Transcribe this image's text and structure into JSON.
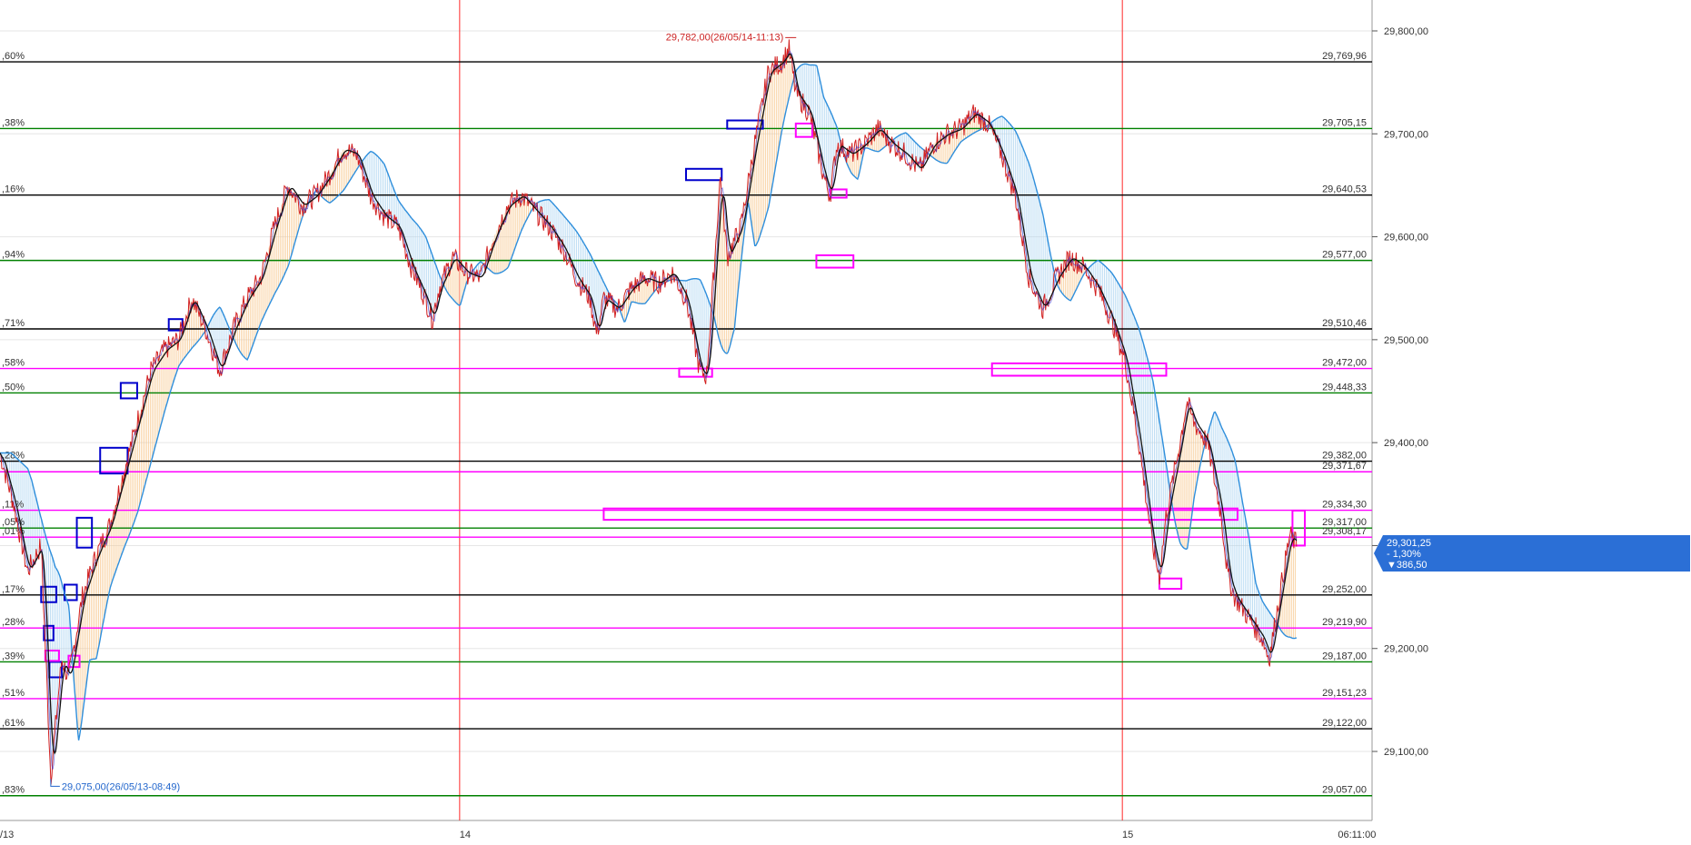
{
  "chart_data": {
    "type": "line",
    "x": [
      "14",
      "15"
    ],
    "y_axis": {
      "ylim": [
        29040,
        29830
      ],
      "ticks": [
        29100,
        29200,
        29300,
        29400,
        29500,
        29600,
        29700,
        29800
      ],
      "tick_labels": [
        "29,100,00",
        "29,200,00",
        "29,300,00",
        "29,400,00",
        "29,500,00",
        "29,600,00",
        "29,700,00",
        "29,800,00"
      ]
    },
    "x_axis": {
      "labels": [
        {
          "text": "/13",
          "frac": 0.0
        },
        {
          "text": "14",
          "frac": 0.335
        },
        {
          "text": "15",
          "frac": 0.818
        },
        {
          "text": "06:11:00",
          "frac": 0.985
        }
      ],
      "day_separators_frac": [
        0.335,
        0.818
      ]
    },
    "fib_levels": [
      {
        "pct": ",60%",
        "value": 29769.96,
        "label": "29,769,96",
        "color": "#000000"
      },
      {
        "pct": ",38%",
        "value": 29705.15,
        "label": "29,705,15",
        "color": "#008000"
      },
      {
        "pct": ",16%",
        "value": 29640.53,
        "label": "29,640,53",
        "color": "#000000"
      },
      {
        "pct": ",94%",
        "value": 29577.0,
        "label": "29,577,00",
        "color": "#008000"
      },
      {
        "pct": ",71%",
        "value": 29510.46,
        "label": "29,510,46",
        "color": "#000000"
      },
      {
        "pct": ",58%",
        "value": 29472.0,
        "label": "29,472,00",
        "color": "#ff00ff"
      },
      {
        "pct": ",50%",
        "value": 29448.33,
        "label": "29,448,33",
        "color": "#008000"
      },
      {
        "pct": ",28%",
        "value": 29382.0,
        "label": "29,382,00",
        "color": "#000000"
      },
      {
        "pct": "",
        "value": 29371.67,
        "label": "29,371,67",
        "color": "#ff00ff"
      },
      {
        "pct": ",11%",
        "value": 29334.3,
        "label": "29,334,30",
        "color": "#ff00ff"
      },
      {
        "pct": ",05%",
        "value": 29317.0,
        "label": "29,317,00",
        "color": "#008000"
      },
      {
        "pct": ",01%",
        "value": 29308.17,
        "label": "29,308,17",
        "color": "#ff00ff"
      },
      {
        "pct": ",17%",
        "value": 29252.0,
        "label": "29,252,00",
        "color": "#000000"
      },
      {
        "pct": ",28%",
        "value": 29219.9,
        "label": "29,219,90",
        "color": "#ff00ff"
      },
      {
        "pct": ",39%",
        "value": 29187.0,
        "label": "29,187,00",
        "color": "#008000"
      },
      {
        "pct": ",51%",
        "value": 29151.23,
        "label": "29,151,23",
        "color": "#ff00ff"
      },
      {
        "pct": ",61%",
        "value": 29122.0,
        "label": "29,122,00",
        "color": "#000000"
      },
      {
        "pct": ",83%",
        "value": 29057.0,
        "label": "29,057,00",
        "color": "#008000"
      }
    ],
    "current_price": {
      "value": 29301.25,
      "label": "29,301,25",
      "change_pct": "- 1,30%",
      "change": "▼386,50"
    },
    "annotations": {
      "high": {
        "text": "29,782,00(26/05/14-11:13)",
        "value": 29782.0,
        "frac": 0.575
      },
      "low": {
        "text": "29,075,00(26/05/13-08:49)",
        "value": 29075.0,
        "frac": 0.037
      }
    },
    "price_series": [
      [
        0.0,
        29390
      ],
      [
        0.01,
        29340
      ],
      [
        0.02,
        29275
      ],
      [
        0.03,
        29300
      ],
      [
        0.037,
        29075
      ],
      [
        0.045,
        29190
      ],
      [
        0.05,
        29170
      ],
      [
        0.06,
        29250
      ],
      [
        0.07,
        29290
      ],
      [
        0.08,
        29320
      ],
      [
        0.09,
        29370
      ],
      [
        0.1,
        29420
      ],
      [
        0.11,
        29470
      ],
      [
        0.12,
        29490
      ],
      [
        0.13,
        29500
      ],
      [
        0.14,
        29540
      ],
      [
        0.15,
        29510
      ],
      [
        0.16,
        29470
      ],
      [
        0.17,
        29510
      ],
      [
        0.18,
        29540
      ],
      [
        0.19,
        29560
      ],
      [
        0.2,
        29610
      ],
      [
        0.21,
        29650
      ],
      [
        0.22,
        29630
      ],
      [
        0.23,
        29640
      ],
      [
        0.24,
        29660
      ],
      [
        0.25,
        29685
      ],
      [
        0.26,
        29680
      ],
      [
        0.27,
        29640
      ],
      [
        0.28,
        29620
      ],
      [
        0.29,
        29610
      ],
      [
        0.3,
        29570
      ],
      [
        0.31,
        29540
      ],
      [
        0.315,
        29520
      ],
      [
        0.32,
        29550
      ],
      [
        0.33,
        29580
      ],
      [
        0.34,
        29565
      ],
      [
        0.35,
        29560
      ],
      [
        0.36,
        29600
      ],
      [
        0.37,
        29630
      ],
      [
        0.38,
        29640
      ],
      [
        0.39,
        29625
      ],
      [
        0.4,
        29610
      ],
      [
        0.41,
        29590
      ],
      [
        0.42,
        29560
      ],
      [
        0.43,
        29540
      ],
      [
        0.435,
        29505
      ],
      [
        0.44,
        29540
      ],
      [
        0.45,
        29530
      ],
      [
        0.46,
        29550
      ],
      [
        0.47,
        29560
      ],
      [
        0.48,
        29555
      ],
      [
        0.49,
        29565
      ],
      [
        0.5,
        29540
      ],
      [
        0.51,
        29470
      ],
      [
        0.515,
        29465
      ],
      [
        0.52,
        29560
      ],
      [
        0.525,
        29660
      ],
      [
        0.53,
        29580
      ],
      [
        0.54,
        29610
      ],
      [
        0.55,
        29690
      ],
      [
        0.56,
        29760
      ],
      [
        0.57,
        29770
      ],
      [
        0.575,
        29782
      ],
      [
        0.58,
        29740
      ],
      [
        0.59,
        29720
      ],
      [
        0.6,
        29660
      ],
      [
        0.605,
        29640
      ],
      [
        0.61,
        29690
      ],
      [
        0.62,
        29680
      ],
      [
        0.63,
        29690
      ],
      [
        0.64,
        29705
      ],
      [
        0.65,
        29690
      ],
      [
        0.66,
        29680
      ],
      [
        0.67,
        29665
      ],
      [
        0.68,
        29690
      ],
      [
        0.69,
        29700
      ],
      [
        0.7,
        29705
      ],
      [
        0.71,
        29720
      ],
      [
        0.72,
        29710
      ],
      [
        0.73,
        29680
      ],
      [
        0.74,
        29640
      ],
      [
        0.75,
        29560
      ],
      [
        0.76,
        29530
      ],
      [
        0.77,
        29560
      ],
      [
        0.78,
        29580
      ],
      [
        0.79,
        29570
      ],
      [
        0.8,
        29550
      ],
      [
        0.81,
        29520
      ],
      [
        0.82,
        29480
      ],
      [
        0.83,
        29400
      ],
      [
        0.84,
        29300
      ],
      [
        0.845,
        29270
      ],
      [
        0.85,
        29330
      ],
      [
        0.86,
        29400
      ],
      [
        0.865,
        29440
      ],
      [
        0.87,
        29420
      ],
      [
        0.88,
        29400
      ],
      [
        0.89,
        29330
      ],
      [
        0.895,
        29270
      ],
      [
        0.9,
        29250
      ],
      [
        0.91,
        29230
      ],
      [
        0.92,
        29210
      ],
      [
        0.925,
        29190
      ],
      [
        0.93,
        29230
      ],
      [
        0.935,
        29270
      ],
      [
        0.94,
        29310
      ],
      [
        0.945,
        29301.25
      ]
    ],
    "rect_markers": [
      {
        "x0": 0.03,
        "x1": 0.041,
        "y0": 29260,
        "y1": 29245,
        "color": "#0000cc"
      },
      {
        "x0": 0.032,
        "x1": 0.039,
        "y0": 29222,
        "y1": 29208,
        "color": "#0000cc"
      },
      {
        "x0": 0.036,
        "x1": 0.045,
        "y0": 29187,
        "y1": 29172,
        "color": "#0000cc"
      },
      {
        "x0": 0.047,
        "x1": 0.056,
        "y0": 29262,
        "y1": 29247,
        "color": "#0000cc"
      },
      {
        "x0": 0.056,
        "x1": 0.067,
        "y0": 29327,
        "y1": 29298,
        "color": "#0000cc"
      },
      {
        "x0": 0.073,
        "x1": 0.093,
        "y0": 29395,
        "y1": 29370,
        "color": "#0000cc"
      },
      {
        "x0": 0.088,
        "x1": 0.1,
        "y0": 29458,
        "y1": 29443,
        "color": "#0000cc"
      },
      {
        "x0": 0.123,
        "x1": 0.133,
        "y0": 29520,
        "y1": 29509,
        "color": "#0000cc"
      },
      {
        "x0": 0.5,
        "x1": 0.526,
        "y0": 29666,
        "y1": 29655,
        "color": "#0000cc"
      },
      {
        "x0": 0.53,
        "x1": 0.556,
        "y0": 29713,
        "y1": 29705,
        "color": "#0000cc"
      },
      {
        "x0": 0.033,
        "x1": 0.043,
        "y0": 29198,
        "y1": 29188,
        "color": "#ff00ff"
      },
      {
        "x0": 0.05,
        "x1": 0.058,
        "y0": 29193,
        "y1": 29182,
        "color": "#ff00ff"
      },
      {
        "x0": 0.495,
        "x1": 0.519,
        "y0": 29472,
        "y1": 29464,
        "color": "#ff00ff"
      },
      {
        "x0": 0.58,
        "x1": 0.592,
        "y0": 29710,
        "y1": 29697,
        "color": "#ff00ff"
      },
      {
        "x0": 0.605,
        "x1": 0.617,
        "y0": 29646,
        "y1": 29638,
        "color": "#ff00ff"
      },
      {
        "x0": 0.595,
        "x1": 0.622,
        "y0": 29582,
        "y1": 29570,
        "color": "#ff00ff"
      },
      {
        "x0": 0.44,
        "x1": 0.902,
        "y0": 29336,
        "y1": 29325,
        "color": "#ff00ff"
      },
      {
        "x0": 0.723,
        "x1": 0.85,
        "y0": 29477,
        "y1": 29465,
        "color": "#ff00ff"
      },
      {
        "x0": 0.845,
        "x1": 0.861,
        "y0": 29268,
        "y1": 29258,
        "color": "#ff00ff"
      },
      {
        "x0": 0.942,
        "x1": 0.951,
        "y0": 29334,
        "y1": 29300,
        "color": "#ff00ff"
      }
    ]
  }
}
